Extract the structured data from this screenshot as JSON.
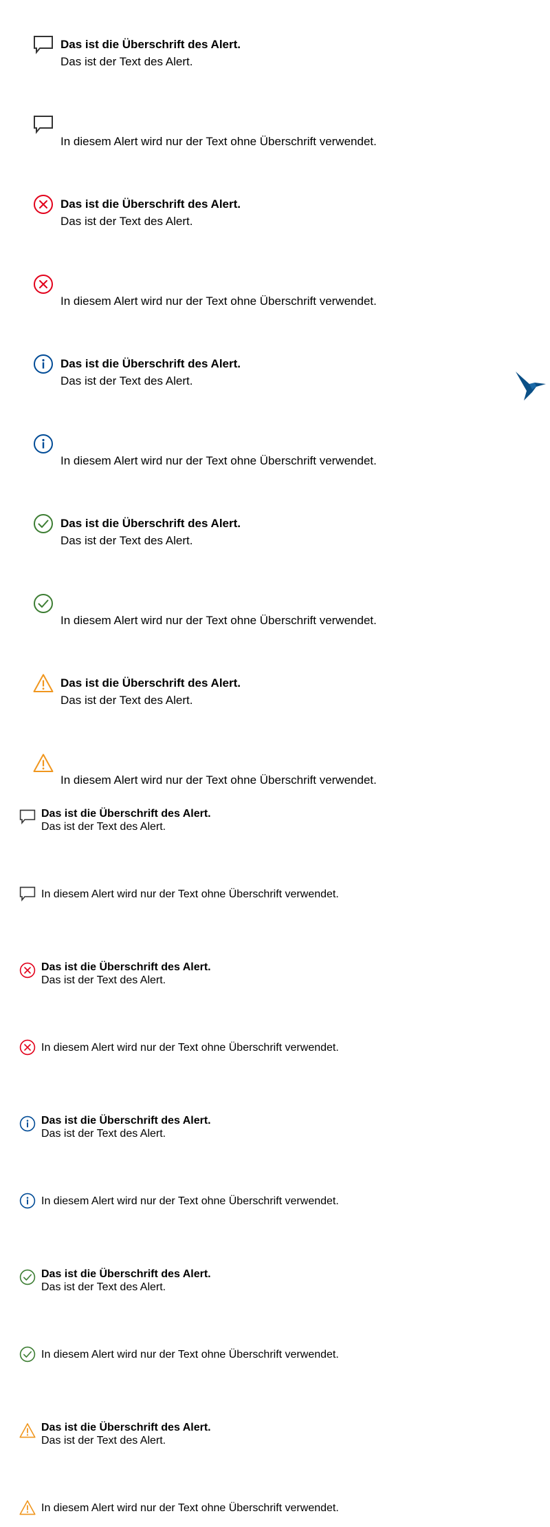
{
  "colors": {
    "message": "#333333",
    "error": "#e2001a",
    "info": "#004b96",
    "success": "#3c7d32",
    "warning": "#f0961e",
    "bird": "#0a4f86"
  },
  "texts": {
    "title": "Das ist die Überschrift des Alert.",
    "body": "Das ist der Text des Alert.",
    "only_text": "In diesem Alert wird nur der Text ohne Überschrift verwendet."
  },
  "alerts_large": [
    {
      "type": "message",
      "icon": "speech-bubble-icon",
      "title": "Das ist die Überschrift des Alert.",
      "text": "Das ist der Text des Alert."
    },
    {
      "type": "message",
      "icon": "speech-bubble-icon",
      "title": "",
      "text": "In diesem Alert wird nur der Text ohne Überschrift verwendet."
    },
    {
      "type": "error",
      "icon": "error-circle-icon",
      "title": "Das ist die Überschrift des Alert.",
      "text": "Das ist der Text des Alert."
    },
    {
      "type": "error",
      "icon": "error-circle-icon",
      "title": "",
      "text": "In diesem Alert wird nur der Text ohne Überschrift verwendet."
    },
    {
      "type": "info",
      "icon": "info-circle-icon",
      "title": "Das ist die Überschrift des Alert.",
      "text": "Das ist der Text des Alert."
    },
    {
      "type": "info",
      "icon": "info-circle-icon",
      "title": "",
      "text": "In diesem Alert wird nur der Text ohne Überschrift verwendet."
    },
    {
      "type": "success",
      "icon": "check-circle-icon",
      "title": "Das ist die Überschrift des Alert.",
      "text": "Das ist der Text des Alert."
    },
    {
      "type": "success",
      "icon": "check-circle-icon",
      "title": "",
      "text": "In diesem Alert wird nur der Text ohne Überschrift verwendet."
    },
    {
      "type": "warning",
      "icon": "warning-triangle-icon",
      "title": "Das ist die Überschrift des Alert.",
      "text": "Das ist der Text des Alert."
    },
    {
      "type": "warning",
      "icon": "warning-triangle-icon",
      "title": "",
      "text": "In diesem Alert wird nur der Text ohne Überschrift verwendet."
    }
  ],
  "alerts_small": [
    {
      "type": "message",
      "icon": "speech-bubble-icon",
      "title": "Das ist die Überschrift des Alert.",
      "text": "Das ist der Text des Alert."
    },
    {
      "type": "message",
      "icon": "speech-bubble-icon",
      "title": "",
      "text": "In diesem Alert wird nur der Text ohne Überschrift verwendet."
    },
    {
      "type": "error",
      "icon": "error-circle-icon",
      "title": "Das ist die Überschrift des Alert.",
      "text": "Das ist der Text des Alert."
    },
    {
      "type": "error",
      "icon": "error-circle-icon",
      "title": "",
      "text": "In diesem Alert wird nur der Text ohne Überschrift verwendet."
    },
    {
      "type": "info",
      "icon": "info-circle-icon",
      "title": "Das ist die Überschrift des Alert.",
      "text": "Das ist der Text des Alert."
    },
    {
      "type": "info",
      "icon": "info-circle-icon",
      "title": "",
      "text": "In diesem Alert wird nur der Text ohne Überschrift verwendet."
    },
    {
      "type": "success",
      "icon": "check-circle-icon",
      "title": "Das ist die Überschrift des Alert.",
      "text": "Das ist der Text des Alert."
    },
    {
      "type": "success",
      "icon": "check-circle-icon",
      "title": "",
      "text": "In diesem Alert wird nur der Text ohne Überschrift verwendet."
    },
    {
      "type": "warning",
      "icon": "warning-triangle-icon",
      "title": "Das ist die Überschrift des Alert.",
      "text": "Das ist der Text des Alert."
    },
    {
      "type": "warning",
      "icon": "warning-triangle-icon",
      "title": "",
      "text": "In diesem Alert wird nur der Text ohne Überschrift verwendet."
    }
  ],
  "logo": {
    "icon": "hummingbird-icon"
  }
}
